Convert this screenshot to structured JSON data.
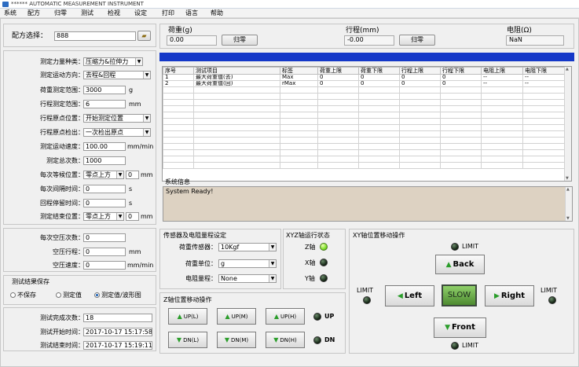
{
  "window": {
    "title": "****** AUTOMATIC MEASUREMENT INSTRUMENT"
  },
  "menu": [
    "系统",
    "配方",
    "归零",
    "测试",
    "检视",
    "设定",
    "打印",
    "语言",
    "帮助"
  ],
  "recipe": {
    "label": "配方选择：",
    "value": "888"
  },
  "params": {
    "force_type": {
      "label": "测定力量种类：",
      "value": "压缩力&拉伸力"
    },
    "motion_dir": {
      "label": "测定运动方向：",
      "value": "去程&回程"
    },
    "load_range": {
      "label": "荷重测定范围：",
      "value": "3000",
      "unit": "g"
    },
    "stroke_range": {
      "label": "行程测定范围：",
      "value": "6",
      "unit": "mm"
    },
    "origin_pos": {
      "label": "行程原点位置：",
      "value": "开始测定位置"
    },
    "origin_detect": {
      "label": "行程原点检出：",
      "value": "一次检出原点"
    },
    "speed": {
      "label": "测定运动速度：",
      "value": "100.00",
      "unit": "mm/min"
    },
    "total_count": {
      "label": "测定总次数：",
      "value": "1000"
    },
    "equal_wait": {
      "label": "每次等候位置：",
      "value": "零点上方",
      "num": "0",
      "unit": "mm"
    },
    "interval": {
      "label": "每次间隔时间：",
      "value": "0",
      "unit": "s"
    },
    "return_stay": {
      "label": "回程停留时间：",
      "value": "0",
      "unit": "s"
    },
    "end_pos": {
      "label": "测定结束位置：",
      "value": "零点上方",
      "num": "0",
      "unit": "mm"
    }
  },
  "idle": {
    "count": {
      "label": "每次空压次数：",
      "value": "0"
    },
    "stroke": {
      "label": "空压行程：",
      "value": "0",
      "unit": "mm"
    },
    "speed": {
      "label": "空压速度：",
      "value": "0",
      "unit": "mm/min"
    }
  },
  "save": {
    "title": "测试结果保存",
    "options": [
      "不保存",
      "测定值",
      "测定值/波形图"
    ],
    "selected": 2
  },
  "status": {
    "done": {
      "label": "测试完成次数：",
      "value": "18"
    },
    "start": {
      "label": "测试开始时间：",
      "value": "2017-10-17 15:17:58"
    },
    "end": {
      "label": "测试结束时间：",
      "value": "2017-10-17 15:19:11"
    }
  },
  "readouts": {
    "load": {
      "label": "荷重(g)",
      "value": "0.00",
      "btn": "归零"
    },
    "stroke": {
      "label": "行程(mm)",
      "value": "-0.00",
      "btn": "归零"
    },
    "resist": {
      "label": "电阻(Ω)",
      "value": "NaN"
    }
  },
  "table": {
    "headers": [
      "序号",
      "测试项目",
      "标签",
      "荷重上限",
      "荷重下限",
      "行程上限",
      "行程下限",
      "电阻上限",
      "电阻下限"
    ],
    "rows": [
      [
        "1",
        "最大荷重值(去)",
        "Max",
        "0",
        "0",
        "0",
        "0",
        "--",
        "--"
      ],
      [
        "2",
        "最大荷重值(回)",
        "rMax",
        "0",
        "0",
        "0",
        "0",
        "--",
        "--"
      ]
    ]
  },
  "syslog": {
    "title": "系统信息",
    "text": "System Ready!"
  },
  "sensor": {
    "title": "传感器及电阻量程设定",
    "load_sensor": {
      "label": "荷重传感器：",
      "value": "10Kgf"
    },
    "load_unit": {
      "label": "荷重单位：",
      "value": "g"
    },
    "resist_range": {
      "label": "电阻量程：",
      "value": "None"
    }
  },
  "xyz": {
    "title": "XYZ轴运行状态",
    "axes": [
      "Z轴",
      "X轴",
      "Y轴"
    ]
  },
  "zmove": {
    "title": "Z轴位置移动操作",
    "up": [
      "UP(L)",
      "UP(M)",
      "UP(H)"
    ],
    "dn": [
      "DN(L)",
      "DN(M)",
      "DN(H)"
    ],
    "up_lamp": "UP",
    "dn_lamp": "DN"
  },
  "xymove": {
    "title": "XY轴位置移动操作",
    "back": "Back",
    "front": "Front",
    "left": "Left",
    "right": "Right",
    "slow": "SLOW",
    "limit": "LIMIT"
  },
  "colors": {
    "accent_bar": "#1438c8",
    "lamp_on": "#7ee02a",
    "status_bg": "#ddd2c2"
  }
}
